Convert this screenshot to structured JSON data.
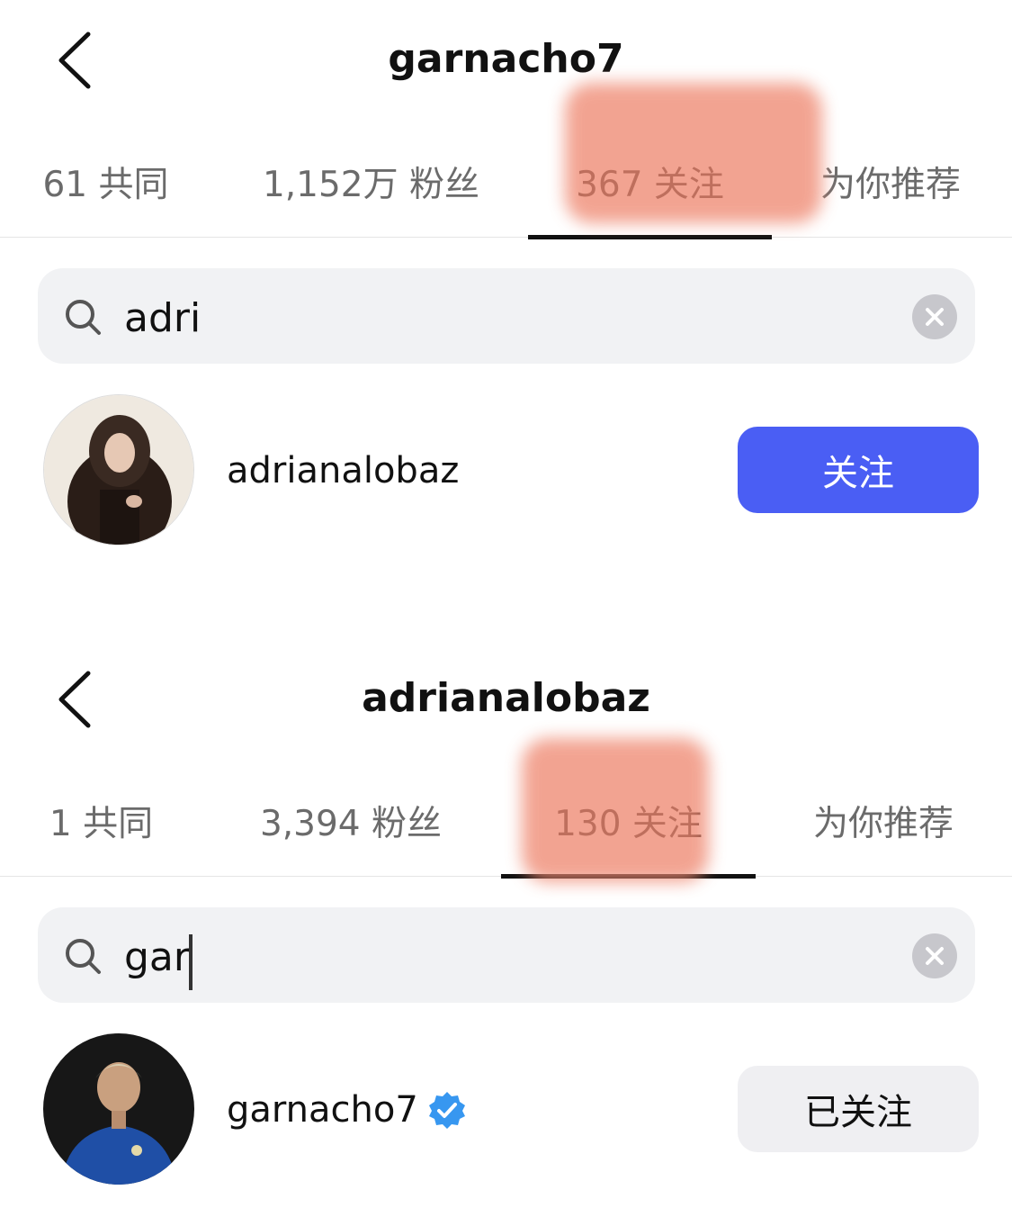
{
  "panel_1": {
    "title": "garnacho7",
    "tabs": [
      {
        "label": "61 共同"
      },
      {
        "label": "1,152万 粉丝"
      },
      {
        "label": "367 关注"
      },
      {
        "label": "为你推荐"
      }
    ],
    "search": {
      "value": "adri"
    },
    "result": {
      "username": "adrianalobaz",
      "button_label": "关注",
      "verified": false
    }
  },
  "panel_2": {
    "title": "adrianalobaz",
    "tabs": [
      {
        "label": "1 共同"
      },
      {
        "label": "3,394 粉丝"
      },
      {
        "label": "130 关注"
      },
      {
        "label": "为你推荐"
      }
    ],
    "search": {
      "value": "gar"
    },
    "result": {
      "username": "garnacho7",
      "button_label": "已关注",
      "verified": true
    }
  },
  "colors": {
    "follow_button": "#4a5ef4",
    "following_button": "#efeff2",
    "verified_badge": "#3797f0",
    "redaction_highlight": "#ef8a73"
  },
  "icons": [
    "chevron-left-icon",
    "search-icon",
    "clear-icon",
    "verified-badge-icon"
  ]
}
